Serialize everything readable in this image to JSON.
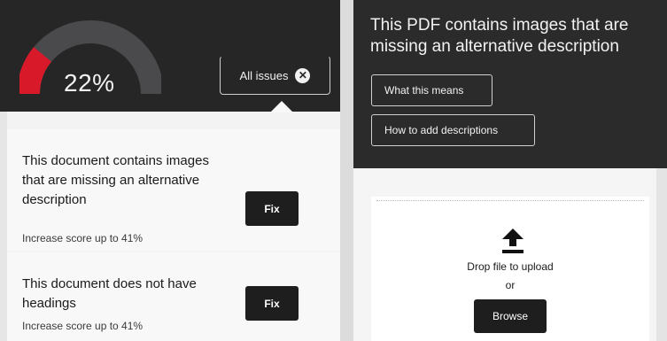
{
  "score": {
    "percent_label": "22%",
    "value": 0.22,
    "colors": {
      "filled": "#d7192a",
      "track": "#4a4a4c"
    }
  },
  "issues_toggle": {
    "label": "All issues",
    "icon": "close-circle-icon"
  },
  "issues": [
    {
      "description": "This document contains images that are missing an alternative description",
      "impact": "Increase score up to 41%",
      "fix_label": "Fix"
    },
    {
      "description": "This document does not have headings",
      "impact": "Increase score up to 41%",
      "fix_label": "Fix"
    }
  ],
  "detail": {
    "title": "This PDF contains images that are missing an alternative description",
    "what_means_label": "What this means",
    "how_to_label": "How to add descriptions"
  },
  "upload": {
    "icon": "upload-arrow-icon",
    "drop_label": "Drop file to upload",
    "or_label": "or",
    "browse_label": "Browse"
  }
}
